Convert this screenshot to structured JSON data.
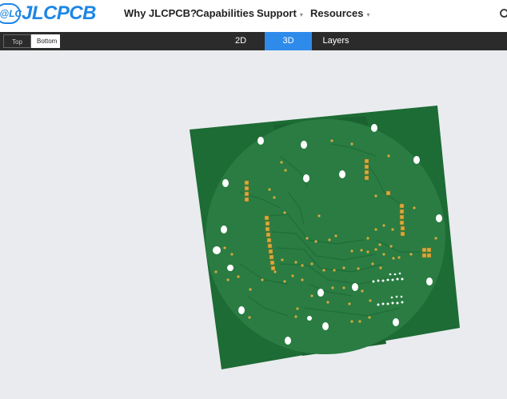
{
  "brand": {
    "badge": "J@LC",
    "name": "JLCPCB"
  },
  "nav": [
    {
      "label": "Why JLCPCB?",
      "dropdown": false
    },
    {
      "label": "Capabilities",
      "dropdown": false
    },
    {
      "label": "Support",
      "dropdown": true
    },
    {
      "label": "Resources",
      "dropdown": true
    }
  ],
  "side_toggle": {
    "top": "Top",
    "bottom": "Bottom",
    "selected": "Bottom"
  },
  "view_tabs": [
    {
      "label": "2D",
      "active": false
    },
    {
      "label": "3D",
      "active": true
    },
    {
      "label": "Layers",
      "active": false
    }
  ],
  "colors": {
    "brand": "#1e86e6",
    "tab_active": "#2f8bea",
    "board": "#1d6b35",
    "board_inner": "#2a7c42",
    "pad": "#d9a93c"
  }
}
